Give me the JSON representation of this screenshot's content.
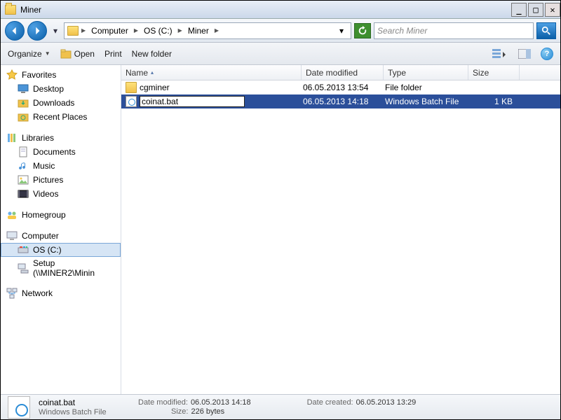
{
  "window": {
    "title": "Miner"
  },
  "breadcrumb": {
    "items": [
      "Computer",
      "OS (C:)",
      "Miner"
    ]
  },
  "search": {
    "placeholder": "Search Miner"
  },
  "toolbar": {
    "organize": "Organize",
    "open": "Open",
    "print": "Print",
    "newFolder": "New folder"
  },
  "sidebar": {
    "favorites": {
      "label": "Favorites",
      "items": [
        "Desktop",
        "Downloads",
        "Recent Places"
      ]
    },
    "libraries": {
      "label": "Libraries",
      "items": [
        "Documents",
        "Music",
        "Pictures",
        "Videos"
      ]
    },
    "homegroup": {
      "label": "Homegroup"
    },
    "computer": {
      "label": "Computer",
      "items": [
        "OS (C:)",
        "Setup (\\\\MINER2\\Minin"
      ]
    },
    "network": {
      "label": "Network"
    }
  },
  "columns": {
    "name": "Name",
    "date": "Date modified",
    "type": "Type",
    "size": "Size"
  },
  "files": [
    {
      "name": "cgminer",
      "date": "06.05.2013 13:54",
      "type": "File folder",
      "size": "",
      "icon": "folder",
      "selected": false,
      "editing": false
    },
    {
      "name": "coinat.bat",
      "date": "06.05.2013 14:18",
      "type": "Windows Batch File",
      "size": "1 KB",
      "icon": "bat",
      "selected": true,
      "editing": true
    }
  ],
  "details": {
    "name": "coinat.bat",
    "type": "Windows Batch File",
    "modifiedLabel": "Date modified:",
    "modified": "06.05.2013 14:18",
    "sizeLabel": "Size:",
    "size": "226 bytes",
    "createdLabel": "Date created:",
    "created": "06.05.2013 13:29"
  }
}
